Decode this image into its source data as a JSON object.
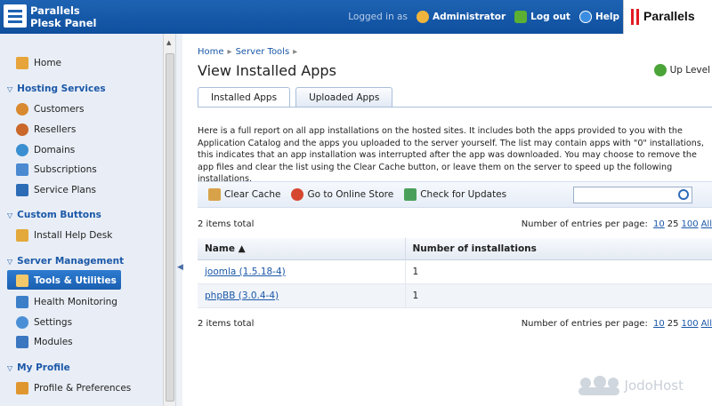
{
  "header": {
    "logo_line1": "Parallels",
    "logo_line2": "Plesk Panel",
    "logged_in_label": "Logged in as",
    "user": "Administrator",
    "logout": "Log out",
    "help": "Help",
    "brand": "Parallels"
  },
  "sidebar": {
    "home": "Home",
    "sections": [
      {
        "title": "Hosting Services",
        "items": [
          "Customers",
          "Resellers",
          "Domains",
          "Subscriptions",
          "Service Plans"
        ]
      },
      {
        "title": "Custom Buttons",
        "items": [
          "Install Help Desk"
        ]
      },
      {
        "title": "Server Management",
        "items": [
          "Tools & Utilities",
          "Health Monitoring",
          "Settings",
          "Modules"
        ]
      },
      {
        "title": "My Profile",
        "items": [
          "Profile & Preferences"
        ]
      }
    ],
    "active_item": "Tools & Utilities"
  },
  "breadcrumb": [
    "Home",
    "Server Tools"
  ],
  "page_title": "View Installed Apps",
  "up_level": "Up Level",
  "tabs": [
    "Installed Apps",
    "Uploaded Apps"
  ],
  "description": "Here is a full report on all app installations on the hosted sites. It includes both the apps provided to you with the Application Catalog and the apps you uploaded to the server yourself. The list may contain apps with \"0\" installations, this indicates that an app installation was interrupted after the app was downloaded. You may choose to remove the app files and clear the list using the Clear Cache button, or leave them on the server to speed up the following installations.",
  "toolbar": {
    "clear_cache": "Clear Cache",
    "online_store": "Go to Online Store",
    "check_updates": "Check for Updates",
    "search_placeholder": ""
  },
  "list": {
    "total": "2 items total",
    "per_page_label": "Number of entries per page:",
    "per_page_options": [
      "10",
      "25",
      "100",
      "All"
    ],
    "columns": [
      "Name ▲",
      "Number of installations"
    ],
    "rows": [
      {
        "name": "joomla (1.5.18-4)",
        "count": "1"
      },
      {
        "name": "phpBB (3.0.4-4)",
        "count": "1"
      }
    ]
  },
  "watermark": "JodoHost"
}
